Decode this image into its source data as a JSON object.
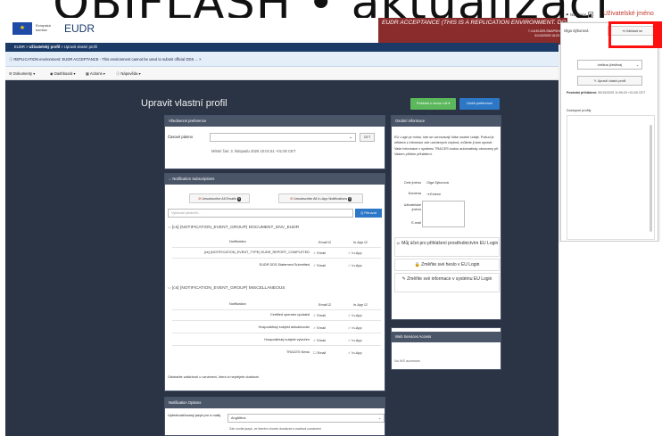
{
  "overlay": {
    "text": "OBIFLASH • aktualizací"
  },
  "header": {
    "eu_commission": "Evropská\nkomise",
    "app_name": "EUDR",
    "env_banner": "EUDR ACCEPTANCE (THIS IS A REPLICATION ENVIRONMENT. DO NO",
    "env_version": "7.4.8.EUDR-SNAPSHOT",
    "env_date": "31/10/2025 18:20:38"
  },
  "nav": {
    "home": "EUDR",
    "profile": "Uživatelský profil",
    "current": "Upravit vlastní profil"
  },
  "infobar": {
    "text": "ⓘ REPLICATION environment: EUDR ACCEPTANCE - This environment cannot be used to submit official DDS ...  ×"
  },
  "menu": {
    "documents": "Dokumenty",
    "dashboard": "Dashboard",
    "actions": "Actions",
    "help": "Nápověda"
  },
  "page": {
    "title": "Upravit vlastní profil",
    "save_new": "Požádat o novou roli ▾",
    "save_pref": "Uložit preference"
  },
  "general": {
    "title": "Všeobecné preference",
    "tz_label": "Časové pásmo",
    "tz_cet": "CET",
    "tz_now": "Místní čas: 3. listopadu 2025 10:01:51 +01:00 CET"
  },
  "notif": {
    "title": "⌵ Notification Subscriptions",
    "unsub_email": "Unsubscribe All Emails",
    "unsub_email_count": "9",
    "unsub_inapp": "Unsubscribe All In-App Notifications",
    "unsub_inapp_count": "9",
    "search_placeholder": "Vyhledat předmět...",
    "filter": "Q Filtrovat",
    "col_notification": "Notification",
    "col_email": "Email",
    "col_inapp": "In-App",
    "groups": [
      {
        "title": "⌵ [cs] (NOTIFICATION_EVENT_GROUP) DOCUMENT_ENV_EUDR",
        "rows": [
          {
            "name": "[cs] (NOTIFICATION_EVENT_TYPE) EUDR_REPORT_COMPLETED",
            "email": "Email",
            "inapp": "In-App"
          },
          {
            "name": "EUDR DDS Statement Submitted",
            "email": "Email",
            "inapp": "In-App"
          }
        ]
      },
      {
        "title": "⌵ [cs] (NOTIFICATION_EVENT_GROUP) MISCELLANEOUS",
        "rows": [
          {
            "name": "Certified operator updated",
            "email": "Email",
            "inapp": "In-App"
          },
          {
            "name": "Hospodářský subjekt aktualizován",
            "email": "Email",
            "inapp": "In-App"
          },
          {
            "name": "Hospodářský subjekt vytvořen",
            "email": "Email",
            "inapp": "In-App"
          },
          {
            "name": "TRACES News",
            "email": "Email",
            "inapp": "In-App"
          }
        ]
      }
    ],
    "note": "Odstraňte zaškrtnutí u oznámení, která si nepřejete dostávat"
  },
  "options": {
    "title": "Notification Options",
    "lang_label": "Upřednostňovaný jazyk pro e-maily",
    "lang_value": "Angličtina",
    "lang_hint": "Zde zvolte jazyk, ve kterém chcete dostávat e-mailová oznámení"
  },
  "personal": {
    "title": "Osobní informace",
    "text": "EU Login je místo, kde se uchovávají Vaše osobní údaje. Pokud je některá z informací zde uvedených chybná, můžete ji tam opravit. Vaše informace v systému TRACES budou automaticky obnoveny při Vašem příštím přihlášení.",
    "full_name_label": "Celé jméno",
    "full_name": "Olga Sýkorová",
    "domain_label": "Doména",
    "domain": "⇥ Externí",
    "username_label": "Uživatelské jméno",
    "email_label": "E-mail",
    "btn_account": "☺ Můj účet pro přihlášení prostřednictvím EU Login",
    "btn_password": "🔒 Změňte své heslo v EU Login",
    "btn_info": "✎ Změňte své informace v systému EU Login"
  },
  "ws": {
    "title": "Web Services Access",
    "none": "No WS accesses"
  },
  "user_menu": {
    "notifications": "Notifikace",
    "notif_count": "0",
    "user_top": "Uživatelské jméno",
    "user": "Olga Sýkorová",
    "logout": "⇥ Odhlásit se",
    "lang": "čeština (čeština)",
    "edit": "✎ Upravit vlastní profil",
    "last_login_label": "Poslední přihlášení:",
    "last_login": "30/10/2025 11:59:20 +01:00 CET",
    "profiles": "Dostupné profily"
  }
}
